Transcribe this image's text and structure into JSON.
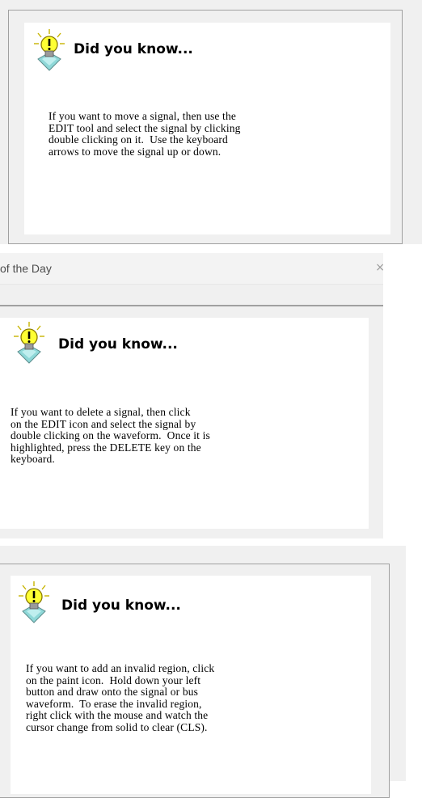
{
  "tips": [
    {
      "title": "Did you know...",
      "body": "If you want to move a signal, then use the\nEDIT tool and select the signal by clicking\ndouble clicking on it.  Use the keyboard\narrows to move the signal up or down."
    },
    {
      "window_title": "of the Day",
      "close_symbol": "×",
      "title": "Did you know...",
      "body": "If you want to delete a signal, then click\non the EDIT icon and select the signal by\ndouble clicking on the waveform.  Once it is\nhighlighted, press the DELETE key on the\nkeyboard."
    },
    {
      "title": "Did you know...",
      "body": "If you want to add an invalid region, click\non the paint icon.  Hold down your left\nbutton and draw onto the signal or bus\nwaveform.  To erase the invalid region,\nright click with the mouse and watch the\ncursor change from solid to clear (CLS)."
    }
  ],
  "icons": {
    "bulb": "lightbulb-icon"
  },
  "colors": {
    "dialog_bg": "#f0f0f0",
    "content_bg": "#ffffff",
    "frame_border": "#a0a0a0",
    "bulb_yellow": "#ffff33",
    "bulb_base": "#8fd8d8"
  }
}
